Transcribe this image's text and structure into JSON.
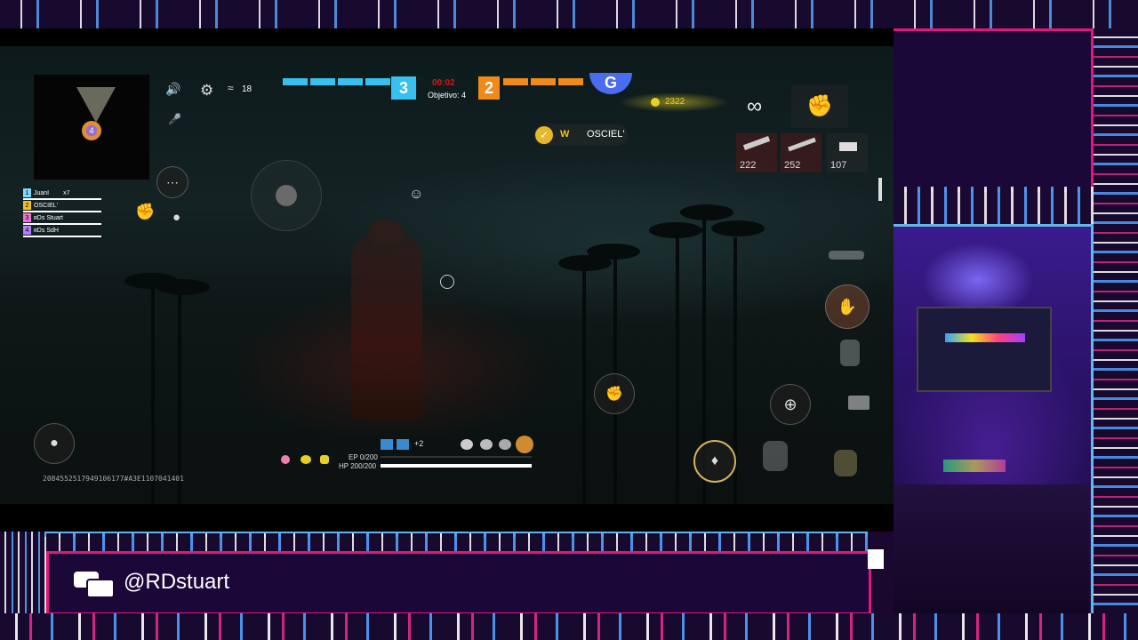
{
  "overlay": {
    "streamer_handle": "@RDstuart",
    "chat_icon": "chat-bubbles-icon",
    "accent_colors": {
      "pink": "#e0187a",
      "cyan": "#5fb4e6",
      "blue": "#4aa0ff",
      "background": "#1a0830"
    }
  },
  "hud": {
    "network": {
      "signal_value": "18",
      "icons": [
        "volume-icon",
        "settings-gear-icon",
        "wifi-icon",
        "microphone-icon"
      ]
    },
    "scoreboard": {
      "team_blue_score": "3",
      "team_orange_score": "2",
      "timer": "00:02",
      "objective_label": "Objetivo: 4",
      "colors": {
        "blue": "#38c0ee",
        "orange": "#f08a1a"
      }
    },
    "currency": {
      "value": "2322",
      "color": "#e8d020"
    },
    "infinity_symbol": "∞",
    "like_player": "OSCIEL'",
    "team_list": [
      {
        "num": "1",
        "name": "JuanI",
        "extra": "x7",
        "color": "#7fd8ff"
      },
      {
        "num": "2",
        "name": "OSCIEL'",
        "extra": "",
        "color": "#f0c020"
      },
      {
        "num": "3",
        "name": "Stuart",
        "extra": "",
        "prefix": "ʀDs",
        "color": "#f070d0"
      },
      {
        "num": "4",
        "name": "SdH",
        "extra": "",
        "prefix": "ʀDs",
        "color": "#b080ff"
      }
    ],
    "weapons": [
      {
        "ammo": "222",
        "icon": "assault-rifle-icon"
      },
      {
        "ammo": "252",
        "icon": "rifle-icon"
      },
      {
        "ammo": "107",
        "icon": "pistol-icon"
      }
    ],
    "stats": {
      "ep": "EP 0/200",
      "hp": "HP 200/200",
      "hp_fraction": 1.0,
      "ep_fraction": 0.0
    },
    "skill_plus": "+2",
    "map_indicator": "4",
    "player_id": "2084552517949106177#A3E1107041401"
  }
}
